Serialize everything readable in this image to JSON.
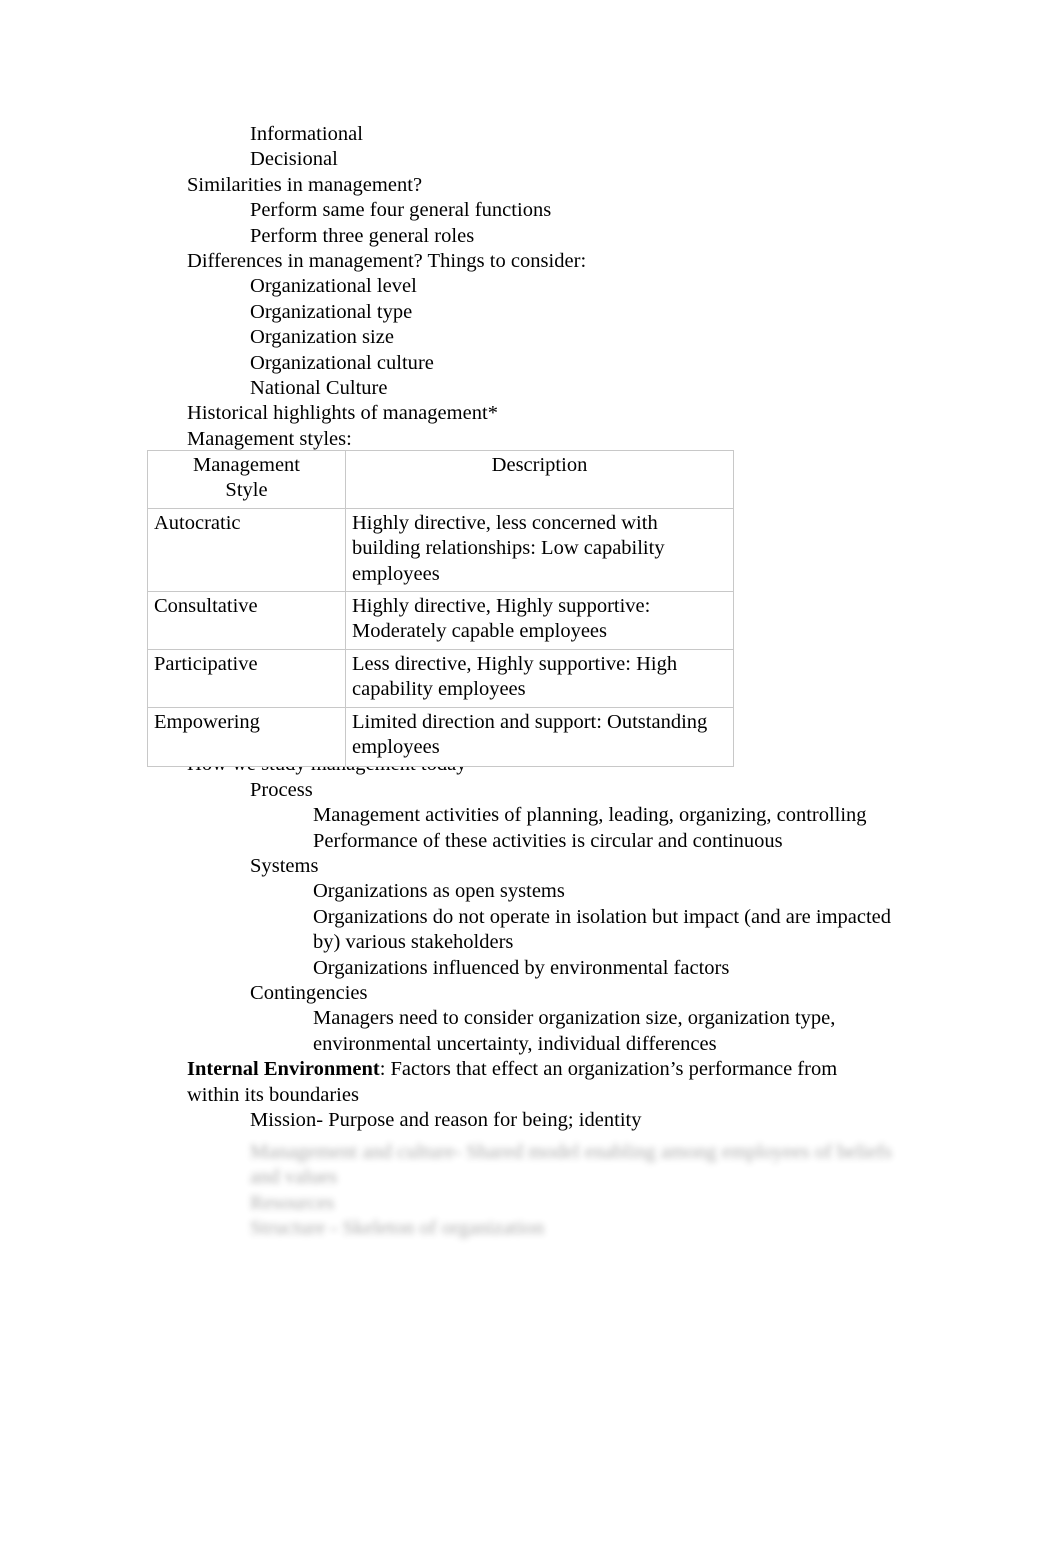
{
  "document": {
    "outline": [
      {
        "indent": 1,
        "text": "Informational"
      },
      {
        "indent": 1,
        "text": "Decisional"
      },
      {
        "indent": 0,
        "text": "Similarities in management?"
      },
      {
        "indent": 1,
        "text": "Perform same four general functions"
      },
      {
        "indent": 1,
        "text": "Perform three general roles"
      },
      {
        "indent": 0,
        "text": "Differences in management? Things to consider:"
      },
      {
        "indent": 1,
        "text": "Organizational level"
      },
      {
        "indent": 1,
        "text": "Organizational type"
      },
      {
        "indent": 1,
        "text": "Organization size"
      },
      {
        "indent": 1,
        "text": "Organizational culture"
      },
      {
        "indent": 1,
        "text": "National Culture"
      },
      {
        "indent": 0,
        "text": "Historical highlights of management*"
      },
      {
        "indent": 0,
        "text": "Management styles:"
      }
    ],
    "outline_items": {
      "informational": "Informational",
      "decisional": "Decisional",
      "similarities_heading": "Similarities in management?",
      "similarities_1": "Perform same four general functions",
      "similarities_2": "Perform three general roles",
      "differences_heading": "Differences in management? Things to consider:",
      "differences_1": "Organizational level",
      "differences_2": "Organizational type",
      "differences_3": "Organization size",
      "differences_4": "Organizational culture",
      "differences_5": "National Culture",
      "historical_highlights": "Historical highlights of management*",
      "management_styles_label": "Management styles:"
    },
    "styles_table": {
      "headers": [
        "Management Style",
        "Description"
      ],
      "header_style_line1": "Management",
      "header_style_line2": "Style",
      "header_description": "Description",
      "rows": [
        {
          "style": "Autocratic",
          "description": "Highly directive, less concerned with building relationships: Low capability employees"
        },
        {
          "style": "Consultative",
          "description": "Highly directive, Highly supportive: Moderately capable employees"
        },
        {
          "style": "Participative",
          "description": "Less directive, Highly supportive: High capability employees"
        },
        {
          "style": "Empowering",
          "description": "Limited direction and support: Outstanding employees"
        }
      ]
    },
    "study_section": {
      "heading": "How we study management today",
      "process_label": "Process",
      "process_1": "Management activities of planning, leading, organizing, controlling",
      "process_2": "Performance of these activities is circular and continuous",
      "systems_label": "Systems",
      "systems_1": "Organizations as open systems",
      "systems_2": "Organizations do not operate in isolation but impact (and are impacted by) various stakeholders",
      "systems_3": "Organizations influenced by environmental factors",
      "contingencies_label": "Contingencies",
      "contingencies_1": "Managers need to consider organization size, organization type, environmental uncertainty, individual differences"
    },
    "internal_environment": {
      "term": "Internal Environment",
      "definition": ": Factors that effect an organization’s performance from within its boundaries",
      "mission": "Mission- Purpose and reason for being; identity"
    },
    "obscured_lines": [
      "Management and culture- Shared model enabling among employees of beliefs",
      "and values",
      "Resources",
      "Structure - Skeleton of organization"
    ]
  }
}
